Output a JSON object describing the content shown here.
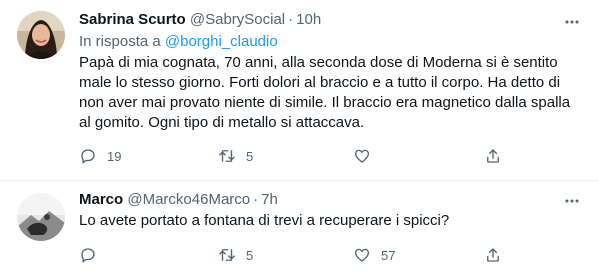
{
  "tweets": [
    {
      "name": "Sabrina Scurto",
      "handle": "@SabrySocial",
      "dot": "·",
      "time": "10h",
      "reply_prefix": "In risposta a",
      "reply_mention": "@borghi_claudio",
      "text": "Papà di mia cognata, 70 anni, alla seconda dose di Moderna si è sentito male lo stesso giorno. Forti dolori al braccio e a tutto il corpo. Ha detto di non aver mai provato niente di simile. Il braccio era magnetico dalla spalla al gomito. Ogni tipo di metallo si attaccava.",
      "replies": "19",
      "retweets": "5",
      "likes": "",
      "more_icon": "more-dots-icon"
    },
    {
      "name": "Marco",
      "handle": "@Marcko46Marco",
      "dot": "·",
      "time": "7h",
      "text": "Lo avete portato a fontana di trevi a recuperare i spicci?",
      "replies": "",
      "retweets": "5",
      "likes": "57",
      "more_icon": "more-dots-icon"
    }
  ],
  "colors": {
    "text": "#0f1419",
    "secondary": "#536471",
    "link": "#1d9bf0",
    "divider": "#eff3f4"
  }
}
